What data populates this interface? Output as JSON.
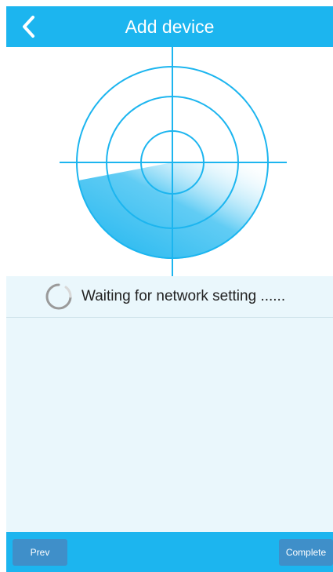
{
  "header": {
    "title": "Add device",
    "back_icon": "chevron-left-icon"
  },
  "status": {
    "text": "Waiting for network setting ......",
    "spinner_icon": "loading-spinner-icon"
  },
  "footer": {
    "prev_label": "Prev",
    "complete_label": "Complete"
  },
  "colors": {
    "accent": "#1cb5ef",
    "button": "#3f8fc9",
    "panel": "#eaf7fc",
    "radar": "#1cb5ef"
  }
}
